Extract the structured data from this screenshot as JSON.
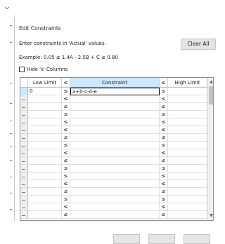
{
  "dialog": {
    "title": "Edit Constraints",
    "instruction": "Enter constraints in 'Actual' values.",
    "example": "Example: 0.05 ≤ 1.4A - 2.5B + C ≤ 0.80",
    "hide_label": "Hide 's' Columns",
    "hide_checked": false,
    "clear_all_label": "Clear All"
  },
  "grid": {
    "headers": [
      "Low Limit",
      "≤",
      "Constraint",
      "≤",
      "High Limit"
    ],
    "rows": [
      {
        "low": "0",
        "lte1": "≤",
        "constraint": "a+b-c-d-e",
        "lte2": "≤",
        "high": ""
      },
      {
        "low": "",
        "lte1": "≤",
        "constraint": "",
        "lte2": "≤",
        "high": ""
      },
      {
        "low": "",
        "lte1": "≤",
        "constraint": "",
        "lte2": "≤",
        "high": ""
      },
      {
        "low": "",
        "lte1": "≤",
        "constraint": "",
        "lte2": "≤",
        "high": ""
      },
      {
        "low": "",
        "lte1": "≤",
        "constraint": "",
        "lte2": "≤",
        "high": ""
      },
      {
        "low": "",
        "lte1": "≤",
        "constraint": "",
        "lte2": "≤",
        "high": ""
      },
      {
        "low": "",
        "lte1": "≤",
        "constraint": "",
        "lte2": "≤",
        "high": ""
      },
      {
        "low": "",
        "lte1": "≤",
        "constraint": "",
        "lte2": "≤",
        "high": ""
      },
      {
        "low": "",
        "lte1": "≤",
        "constraint": "",
        "lte2": "≤",
        "high": ""
      },
      {
        "low": "",
        "lte1": "≤",
        "constraint": "",
        "lte2": "≤",
        "high": ""
      },
      {
        "low": "",
        "lte1": "≤",
        "constraint": "",
        "lte2": "≤",
        "high": ""
      },
      {
        "low": "",
        "lte1": "≤",
        "constraint": "",
        "lte2": "≤",
        "high": ""
      },
      {
        "low": "",
        "lte1": "≤",
        "constraint": "",
        "lte2": "≤",
        "high": ""
      },
      {
        "low": "",
        "lte1": "≤",
        "constraint": "",
        "lte2": "≤",
        "high": ""
      },
      {
        "low": "",
        "lte1": "≤",
        "constraint": "",
        "lte2": "≤",
        "high": ""
      },
      {
        "low": "",
        "lte1": "≤",
        "constraint": "",
        "lte2": "≤",
        "high": ""
      },
      {
        "low": "",
        "lte1": "≤",
        "constraint": "",
        "lte2": "≤",
        "high": ""
      }
    ],
    "scroll_up_icon": "chevron-up-icon",
    "scroll_down_icon": "chevron-down-icon"
  },
  "colors": {
    "selected_header": "#cce8ff",
    "button_face": "#e5e5e5"
  }
}
